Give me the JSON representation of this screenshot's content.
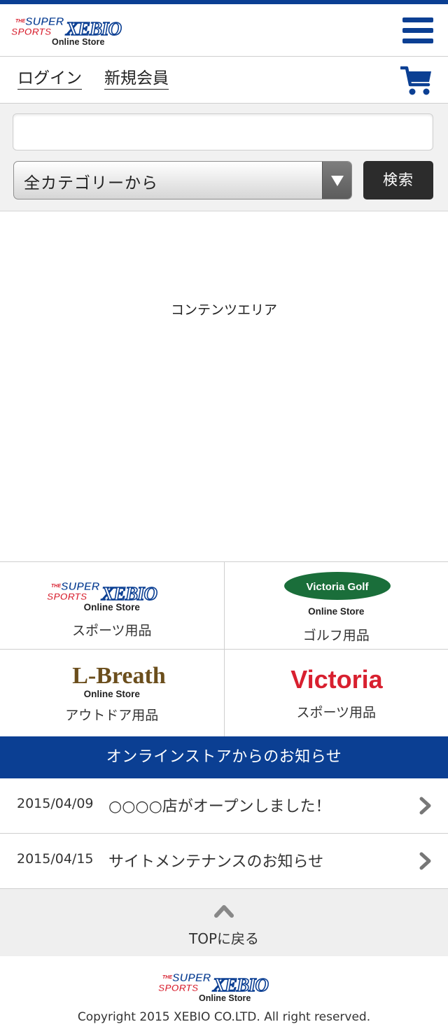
{
  "header": {
    "brand_top": "THE",
    "brand_super": "SUPER",
    "brand_sports": "SPORTS",
    "brand_name": "XEBIO",
    "brand_sub": "Online Store",
    "menu_icon": "hamburger-menu-icon"
  },
  "account": {
    "login": "ログイン",
    "register": "新規会員",
    "cart_icon": "shopping-cart-icon"
  },
  "search": {
    "input_value": "",
    "category_selected": "全カテゴリーから",
    "button": "検索"
  },
  "content": {
    "placeholder": "コンテンツエリア"
  },
  "stores": [
    {
      "logo": "XEBIO",
      "logo_sub": "Online Store",
      "caption": "スポーツ用品"
    },
    {
      "logo": "Victoria Golf",
      "logo_sub": "Online Store",
      "caption": "ゴルフ用品"
    },
    {
      "logo": "L-Breath",
      "logo_sub": "Online Store",
      "caption": "アウトドア用品"
    },
    {
      "logo": "Victoria",
      "caption": "スポーツ用品"
    }
  ],
  "news": {
    "heading": "オンラインストアからのお知らせ",
    "items": [
      {
        "date": "2015/04/09",
        "title": "○○○○店がオープンしました！"
      },
      {
        "date": "2015/04/15",
        "title": "サイトメンテナンスのお知らせ"
      }
    ]
  },
  "totop": {
    "label": "TOPに戻る"
  },
  "footer": {
    "brand_sub": "Online Store",
    "copyright": "Copyright 2015 XEBIO CO.LTD. All right reserved."
  },
  "colors": {
    "brand_blue": "#0b3f93",
    "golf_green": "#1a6e3a",
    "lbreath_brown": "#6b4e1c",
    "victoria_red": "#d8202f"
  }
}
